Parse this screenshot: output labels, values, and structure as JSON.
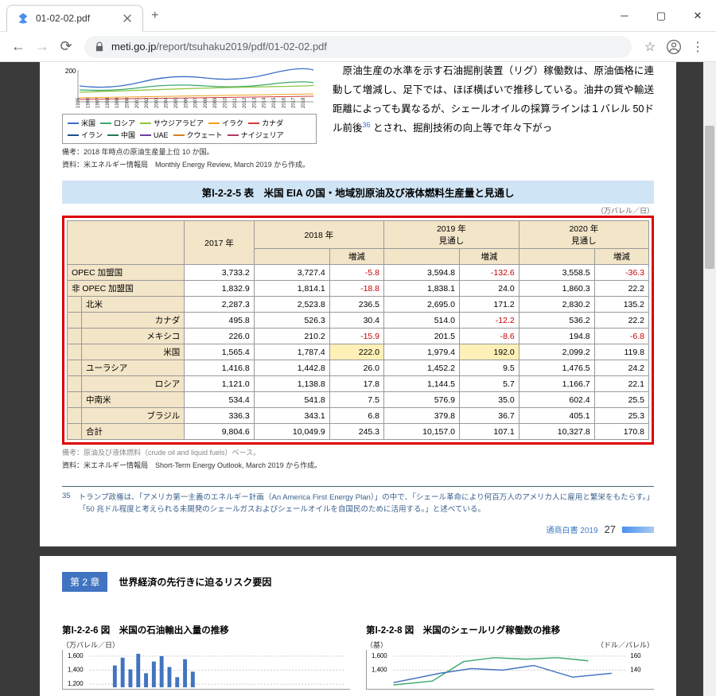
{
  "window": {
    "tab_title": "01-02-02.pdf",
    "url_host": "meti.go.jp",
    "url_path": "/report/tsuhaku2019/pdf/01-02-02.pdf"
  },
  "chart_legend": {
    "items": [
      {
        "label": "米国",
        "color": "#3a6fc8"
      },
      {
        "label": "ロシア",
        "color": "#3fa86f"
      },
      {
        "label": "サウジアラビア",
        "color": "#8ec640"
      },
      {
        "label": "イラク",
        "color": "#f0a020"
      },
      {
        "label": "カナダ",
        "color": "#d13a3a"
      },
      {
        "label": "イラン",
        "color": "#1e4f8c"
      },
      {
        "label": "中国",
        "color": "#1f7a4f"
      },
      {
        "label": "UAE",
        "color": "#6a3fa0"
      },
      {
        "label": "クウェート",
        "color": "#d48020"
      },
      {
        "label": "ナイジェリア",
        "color": "#b03a5a"
      }
    ],
    "note1": "備考：2018 年時点の原油生産量上位 10 か国。",
    "note2": "資料：米エネルギー情報局　Monthly Energy Review, March 2019 から作成。",
    "y_tick": "200",
    "x_years": [
      "1995",
      "1996",
      "1997",
      "1998",
      "1999",
      "2000",
      "2001",
      "2002",
      "2003",
      "2004",
      "2005",
      "2006",
      "2007",
      "2008",
      "2009",
      "2010",
      "2011",
      "2012",
      "2013",
      "2014",
      "2015",
      "2016",
      "2017",
      "2018"
    ]
  },
  "right_para": {
    "line1": "　原油生産の水準を示す石油掘削装置（リグ）稼働数は、原油価格に連動して増減し、足下では、ほぼ横ばいで推移している。油井の質や輸送距離によっても異なるが、シェールオイルの採算ラインは１バレル 50ドル前後",
    "sup": "36",
    "line2": " とされ、掘削技術の向上等で年々下がっ"
  },
  "table_caption": "第Ⅰ-2-2-5 表　米国 EIA の国・地域別原油及び液体燃料生産量と見通し",
  "unit_note": "（万バレル／日）",
  "table": {
    "headers": {
      "y2017": "2017 年",
      "y2018": "2018 年",
      "inc18": "増減",
      "y2019": "2019 年\n見通し",
      "inc19": "増減",
      "y2020": "2020 年\n見通し",
      "inc20": "増減"
    },
    "rows": [
      {
        "label": "OPEC 加盟国",
        "indent": 0,
        "v": [
          "3,733.2",
          "3,727.4",
          "-5.8",
          "3,594.8",
          "-132.6",
          "3,558.5",
          "-36.3"
        ],
        "neg": [
          2,
          4,
          6
        ]
      },
      {
        "label": "非 OPEC 加盟国",
        "indent": 0,
        "v": [
          "1,832.9",
          "1,814.1",
          "-18.8",
          "1,838.1",
          "24.0",
          "1,860.3",
          "22.2"
        ],
        "neg": [
          2
        ]
      },
      {
        "label": "北米",
        "indent": 1,
        "v": [
          "2,287.3",
          "2,523.8",
          "236.5",
          "2,695.0",
          "171.2",
          "2,830.2",
          "135.2"
        ],
        "neg": []
      },
      {
        "label": "カナダ",
        "indent": 2,
        "v": [
          "495.8",
          "526.3",
          "30.4",
          "514.0",
          "-12.2",
          "536.2",
          "22.2"
        ],
        "neg": [
          4
        ]
      },
      {
        "label": "メキシコ",
        "indent": 2,
        "v": [
          "226.0",
          "210.2",
          "-15.9",
          "201.5",
          "-8.6",
          "194.8",
          "-6.8"
        ],
        "neg": [
          2,
          4,
          6
        ]
      },
      {
        "label": "米国",
        "indent": 2,
        "v": [
          "1,565.4",
          "1,787.4",
          "222.0",
          "1,979.4",
          "192.0",
          "2,099.2",
          "119.8"
        ],
        "neg": [],
        "hl": [
          2,
          4
        ]
      },
      {
        "label": "ユーラシア",
        "indent": 1,
        "v": [
          "1,416.8",
          "1,442.8",
          "26.0",
          "1,452.2",
          "9.5",
          "1,476.5",
          "24.2"
        ],
        "neg": []
      },
      {
        "label": "ロシア",
        "indent": 2,
        "v": [
          "1,121.0",
          "1,138.8",
          "17.8",
          "1,144.5",
          "5.7",
          "1,166.7",
          "22.1"
        ],
        "neg": []
      },
      {
        "label": "中南米",
        "indent": 1,
        "v": [
          "534.4",
          "541.8",
          "7.5",
          "576.9",
          "35.0",
          "602.4",
          "25.5"
        ],
        "neg": []
      },
      {
        "label": "ブラジル",
        "indent": 2,
        "v": [
          "336.3",
          "343.1",
          "6.8",
          "379.8",
          "36.7",
          "405.1",
          "25.3"
        ],
        "neg": []
      },
      {
        "label": "合計",
        "indent": 1,
        "v": [
          "9,804.6",
          "10,049.9",
          "245.3",
          "10,157.0",
          "107.1",
          "10,327.8",
          "170.8"
        ],
        "neg": []
      }
    ],
    "footer_note1": "備考：原油及び液体燃料（crude oil and liquid fuels）ベース。",
    "footer_note2": "資料：米エネルギー情報局　Short-Term Energy Outlook, March 2019 から作成。"
  },
  "footnote": {
    "num": "35",
    "text": "トランプ政権は、「アメリカ第一主義のエネルギー計画（An America First Energy Plan）」の中で、「シェール革命により何百万人のアメリカ人に雇用と繁栄をもたらす。」「50 兆ドル程度と考えられる未開発のシェールガスおよびシェールオイルを自国民のために活用する。」と述べている。"
  },
  "pagination": {
    "book": "通商白書  2019",
    "page": "27"
  },
  "chapter": {
    "num": "第 2 章",
    "title": "世界経済の先行きに迫るリスク要因"
  },
  "sub1": {
    "title": "第Ⅰ-2-2-6 図　米国の石油輸出入量の推移",
    "unit": "（万バレル／日）",
    "ticks": [
      "1,600",
      "1,400",
      "1,200"
    ]
  },
  "sub2": {
    "title": "第Ⅰ-2-2-8 図　米国のシェールリグ稼働数の推移",
    "unit_l": "（基）",
    "unit_r": "（ドル／バレル）",
    "ticks_l": [
      "1,600",
      "1,400"
    ],
    "ticks_r": [
      "160",
      "140"
    ]
  },
  "chart_data": {
    "type": "table",
    "title": "米国 EIA の国・地域別原油及び液体燃料生産量と見通し（万バレル／日）",
    "columns": [
      "地域",
      "2017年",
      "2018年",
      "増減",
      "2019年見通し",
      "増減",
      "2020年見通し",
      "増減"
    ],
    "rows": [
      [
        "OPEC加盟国",
        3733.2,
        3727.4,
        -5.8,
        3594.8,
        -132.6,
        3558.5,
        -36.3
      ],
      [
        "非OPEC加盟国",
        1832.9,
        1814.1,
        -18.8,
        1838.1,
        24.0,
        1860.3,
        22.2
      ],
      [
        "北米",
        2287.3,
        2523.8,
        236.5,
        2695.0,
        171.2,
        2830.2,
        135.2
      ],
      [
        "カナダ",
        495.8,
        526.3,
        30.4,
        514.0,
        -12.2,
        536.2,
        22.2
      ],
      [
        "メキシコ",
        226.0,
        210.2,
        -15.9,
        201.5,
        -8.6,
        194.8,
        -6.8
      ],
      [
        "米国",
        1565.4,
        1787.4,
        222.0,
        1979.4,
        192.0,
        2099.2,
        119.8
      ],
      [
        "ユーラシア",
        1416.8,
        1442.8,
        26.0,
        1452.2,
        9.5,
        1476.5,
        24.2
      ],
      [
        "ロシア",
        1121.0,
        1138.8,
        17.8,
        1144.5,
        5.7,
        1166.7,
        22.1
      ],
      [
        "中南米",
        534.4,
        541.8,
        7.5,
        576.9,
        35.0,
        602.4,
        25.5
      ],
      [
        "ブラジル",
        336.3,
        343.1,
        6.8,
        379.8,
        36.7,
        405.1,
        25.3
      ],
      [
        "合計",
        9804.6,
        10049.9,
        245.3,
        10157.0,
        107.1,
        10327.8,
        170.8
      ]
    ]
  }
}
